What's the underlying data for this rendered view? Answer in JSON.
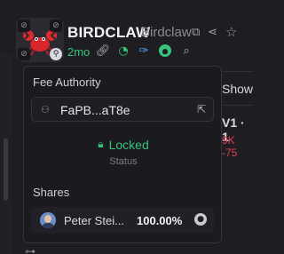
{
  "header": {
    "symbol": "BIRDCLAW",
    "name": "Birdclaw",
    "age": "2mo",
    "icons": {
      "avatar_corners": [
        "eye-off-icon",
        "eye-off-icon",
        "eye-off-icon",
        "link-badge-icon"
      ],
      "title_actions": [
        "copy-icon",
        "share-icon",
        "star-icon"
      ],
      "meta_actions": [
        "link-icon",
        "clock-icon",
        "feather-icon",
        "github-icon",
        "search-icon"
      ]
    },
    "colors": {
      "age": "#37c47a",
      "clock": "#37c47a",
      "feather": "#4fa3f7",
      "github": "#37c47a"
    }
  },
  "background": {
    "show_label": "Show",
    "v1_label": "V1 · 1",
    "red_values": "9K  -75",
    "red_color": "#e0424e",
    "bottom_glyph": "⊶"
  },
  "popover": {
    "fee_authority_label": "Fee Authority",
    "fee_authority_address": "FaPB...aT8e",
    "lock_status": "Locked",
    "status_label": "Status",
    "shares_label": "Shares",
    "shares": [
      {
        "name": "Peter Stei...",
        "percent": "100.00%",
        "icon": "github-icon"
      }
    ],
    "locked_color": "#37c47a"
  }
}
